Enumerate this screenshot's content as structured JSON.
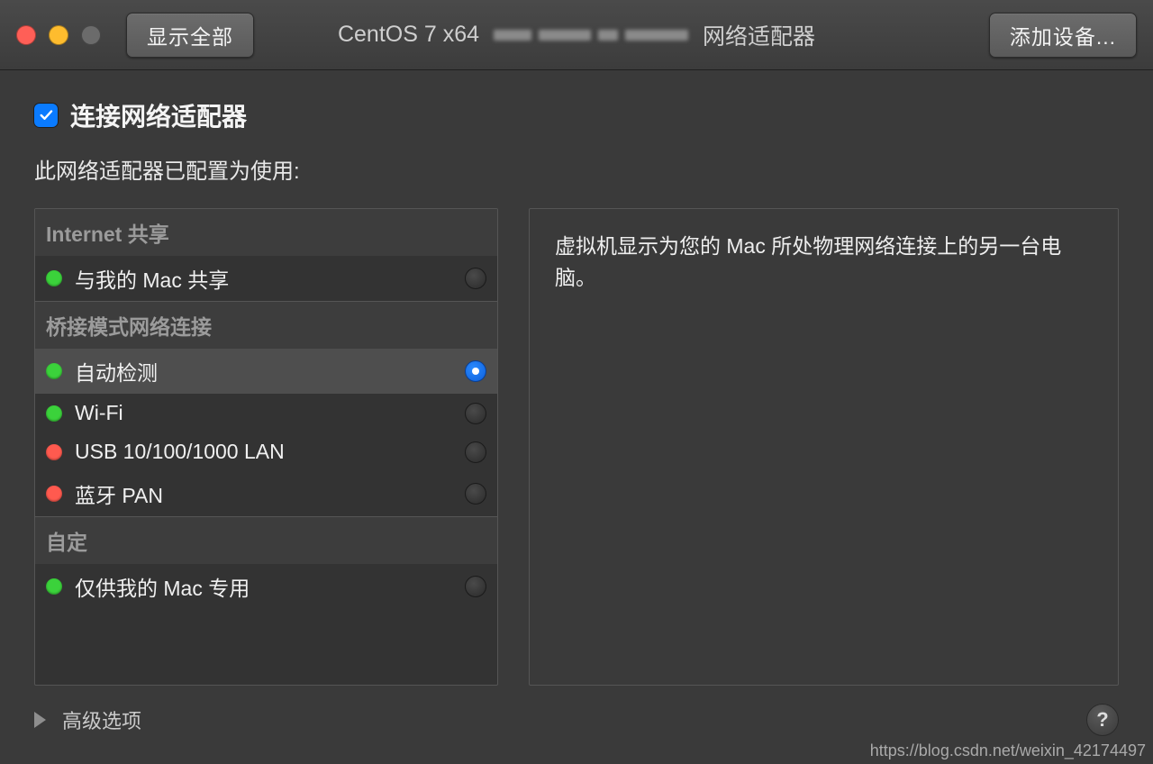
{
  "toolbar": {
    "show_all": "显示全部",
    "title_prefix": "CentOS 7 x64",
    "title_suffix": "网络适配器",
    "add_device": "添加设备..."
  },
  "connect": {
    "checked": true,
    "label": "连接网络适配器"
  },
  "subhead": "此网络适配器已配置为使用:",
  "sections": [
    {
      "title": "Internet 共享",
      "items": [
        {
          "status": "green",
          "label": "与我的 Mac 共享",
          "selected": false
        }
      ]
    },
    {
      "title": "桥接模式网络连接",
      "items": [
        {
          "status": "green",
          "label": "自动检测",
          "selected": true
        },
        {
          "status": "green",
          "label": "Wi-Fi",
          "selected": false
        },
        {
          "status": "red",
          "label": "USB 10/100/1000 LAN",
          "selected": false
        },
        {
          "status": "red",
          "label": "蓝牙 PAN",
          "selected": false
        }
      ]
    },
    {
      "title": "自定",
      "items": [
        {
          "status": "green",
          "label": "仅供我的 Mac 专用",
          "selected": false
        }
      ]
    }
  ],
  "description": "虚拟机显示为您的 Mac 所处物理网络连接上的另一台电脑。",
  "advanced": "高级选项",
  "help": "?",
  "watermark": "https://blog.csdn.net/weixin_42174497"
}
